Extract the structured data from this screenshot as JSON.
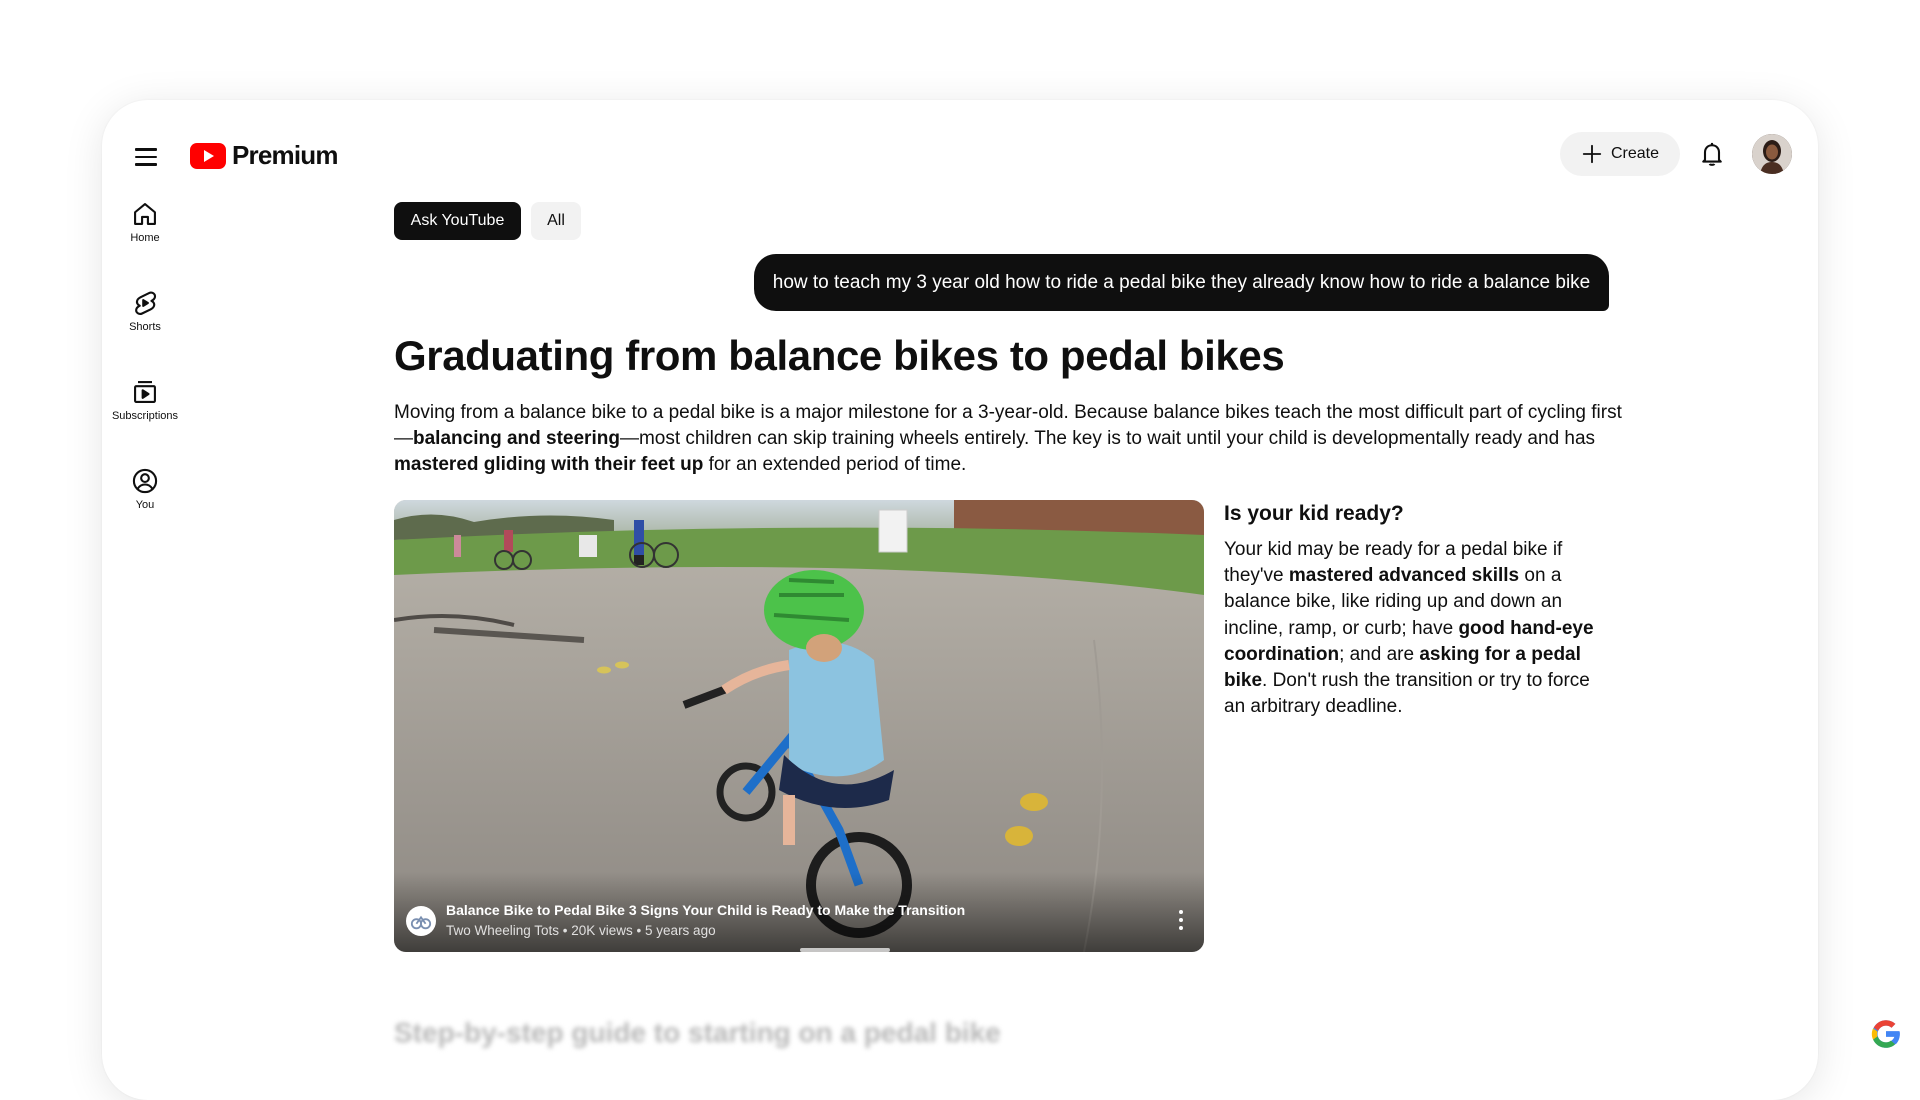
{
  "header": {
    "brand": "Premium",
    "create_label": "Create",
    "icons": [
      "menu-icon",
      "youtube-logo-icon",
      "plus-icon",
      "bell-icon"
    ]
  },
  "sidebar": {
    "items": [
      {
        "label": "Home",
        "icon": "home-icon"
      },
      {
        "label": "Shorts",
        "icon": "shorts-icon"
      },
      {
        "label": "Subscriptions",
        "icon": "subscriptions-icon"
      },
      {
        "label": "You",
        "icon": "account-circle-icon"
      }
    ]
  },
  "chips": {
    "ask": "Ask YouTube",
    "all": "All"
  },
  "query": "how to teach my 3 year old how to ride a pedal bike they already know how to ride a balance bike",
  "answer": {
    "title": "Graduating from balance bikes to pedal bikes",
    "intro": {
      "p1": "Moving from a balance bike to a pedal bike is a major milestone for a 3-year-old. Because balance bikes teach the most difficult part of cycling first—",
      "b1": "balancing and steering",
      "p2": "—most children can skip training wheels entirely. The key is to wait until your child is developmentally ready and has ",
      "b2": "mastered gliding with their feet up",
      "p3": " for an extended period of time."
    },
    "side": {
      "title": "Is your kid ready?",
      "t1": "Your kid may be ready for a pedal bike if they've ",
      "b1": "mastered advanced skills",
      "t2": " on a balance bike, like riding up and down an incline, ramp, or curb; have ",
      "b2": "good hand-eye coordination",
      "t3": "; and are ",
      "b3": "asking for a pedal bike",
      "t4": ". Don't rush the transition or try to force an arbitrary deadline."
    },
    "next_heading": "Step-by-step guide to starting on a pedal bike"
  },
  "video": {
    "title": "Balance Bike to Pedal Bike 3 Signs Your Child is Ready to Make the Transition",
    "meta": "Two Wheeling Tots • 20K views • 5 years ago",
    "progress_fraction": 0.1
  },
  "colors": {
    "youtube_red": "#ff0000",
    "text": "#0f0f0f",
    "chip_bg": "#f2f2f2"
  }
}
